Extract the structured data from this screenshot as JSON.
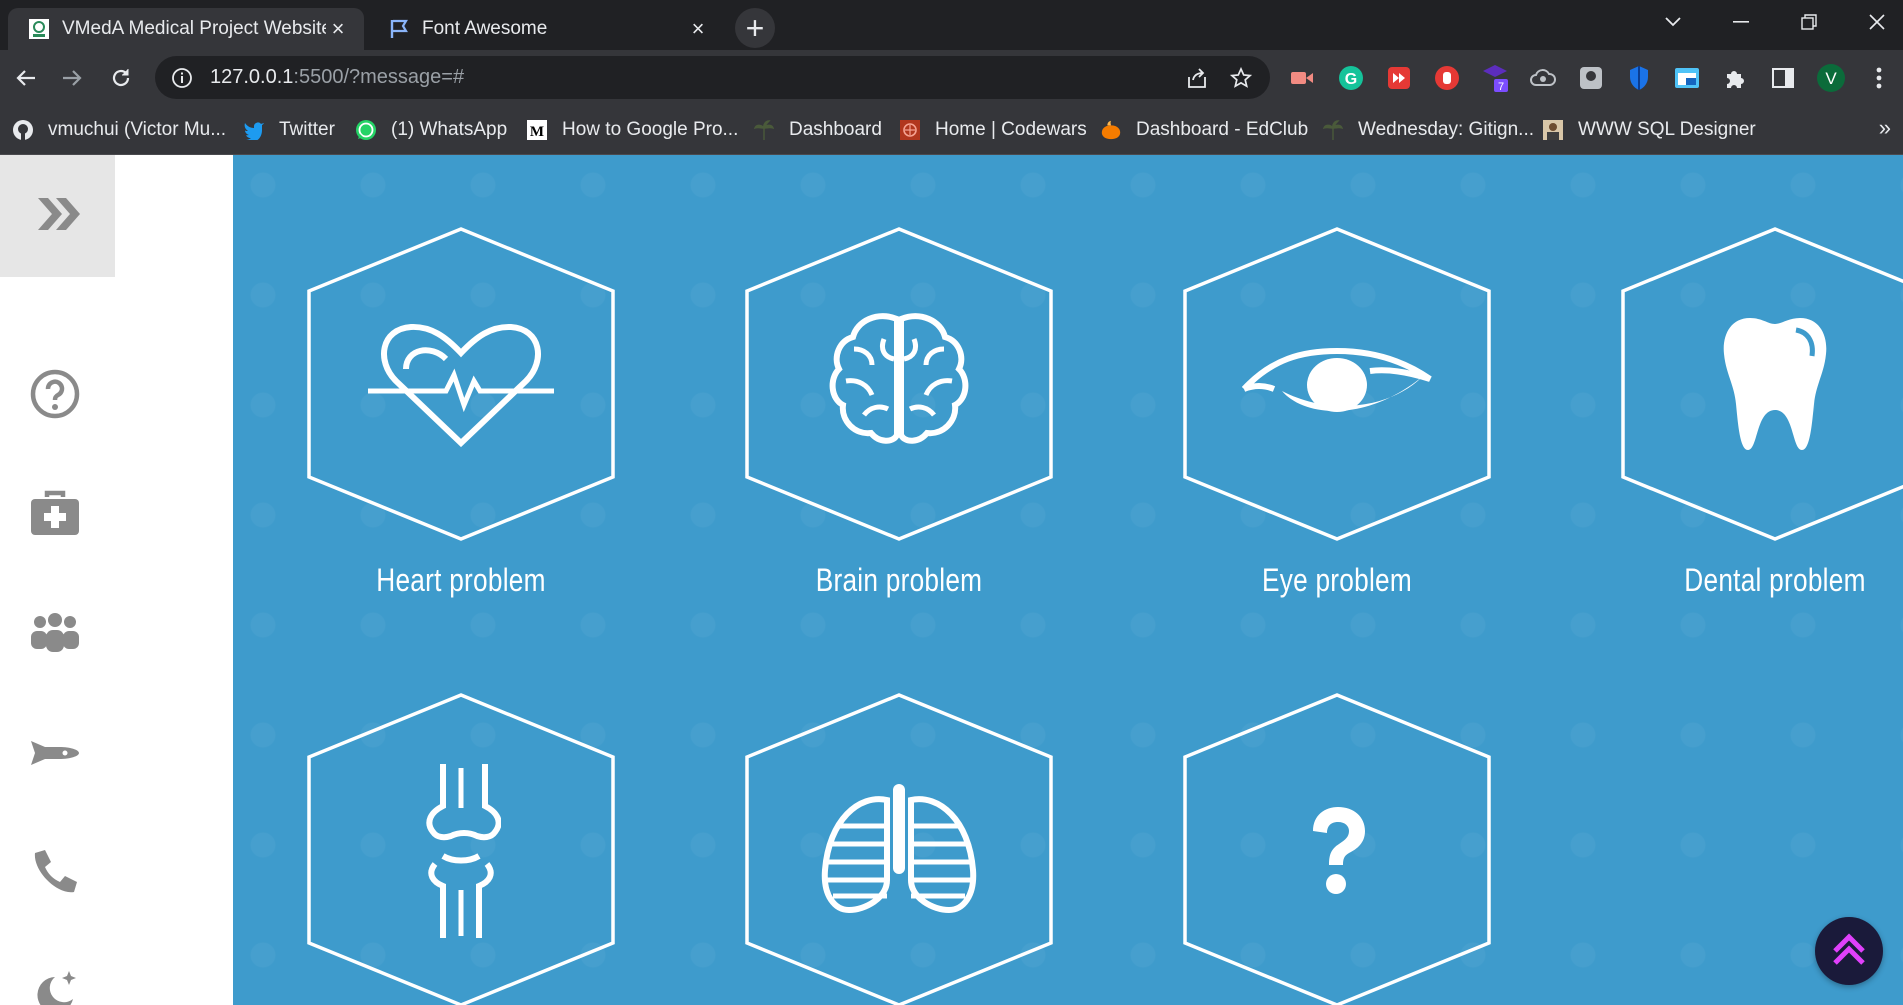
{
  "tabs": [
    {
      "title": "VMedA Medical Project Website",
      "active": true,
      "icon": "vmeda-favicon-icon"
    },
    {
      "title": "Font Awesome",
      "active": false,
      "icon": "flag-icon"
    }
  ],
  "address_bar": {
    "url_host": "127.0.0.1",
    "url_rest": ":5500/?message=#"
  },
  "profile_initial": "V",
  "extension_badge": "7",
  "bookmarks": [
    {
      "label": "vmuchui (Victor Mu...",
      "icon": "github-icon"
    },
    {
      "label": "Twitter",
      "icon": "twitter-icon"
    },
    {
      "label": "(1) WhatsApp",
      "icon": "whatsapp-icon"
    },
    {
      "label": "How to Google Pro...",
      "icon": "medium-icon"
    },
    {
      "label": "Dashboard",
      "icon": "palm-icon"
    },
    {
      "label": "Home | Codewars",
      "icon": "codewars-icon"
    },
    {
      "label": "Dashboard - EdClub",
      "icon": "edclub-icon"
    },
    {
      "label": "Wednesday: Gitign...",
      "icon": "palm-icon"
    },
    {
      "label": "WWW SQL Designer",
      "icon": "avatar-icon"
    }
  ],
  "sidebar": {
    "items": [
      {
        "name": "help",
        "icon": "question-circle-icon"
      },
      {
        "name": "medical-kit",
        "icon": "medkit-icon"
      },
      {
        "name": "team",
        "icon": "people-group-icon"
      },
      {
        "name": "ambulance",
        "icon": "shuttle-icon"
      },
      {
        "name": "contact",
        "icon": "phone-icon"
      },
      {
        "name": "dark-mode",
        "icon": "moon-stars-icon"
      }
    ]
  },
  "tiles": [
    {
      "label": "Heart problem",
      "icon": "heart-pulse-icon"
    },
    {
      "label": "Brain problem",
      "icon": "brain-icon"
    },
    {
      "label": "Eye problem",
      "icon": "eye-icon"
    },
    {
      "label": "Dental problem",
      "icon": "tooth-icon"
    },
    {
      "label": "",
      "icon": "bone-joint-icon"
    },
    {
      "label": "",
      "icon": "lungs-icon"
    },
    {
      "label": "",
      "icon": "question-mark-icon"
    }
  ],
  "colors": {
    "page_background": "#3e9bcc",
    "sidebar_background": "#ffffff",
    "sidebar_icon": "#8a8a8a",
    "scroll_top_accent": "#e040fb"
  }
}
